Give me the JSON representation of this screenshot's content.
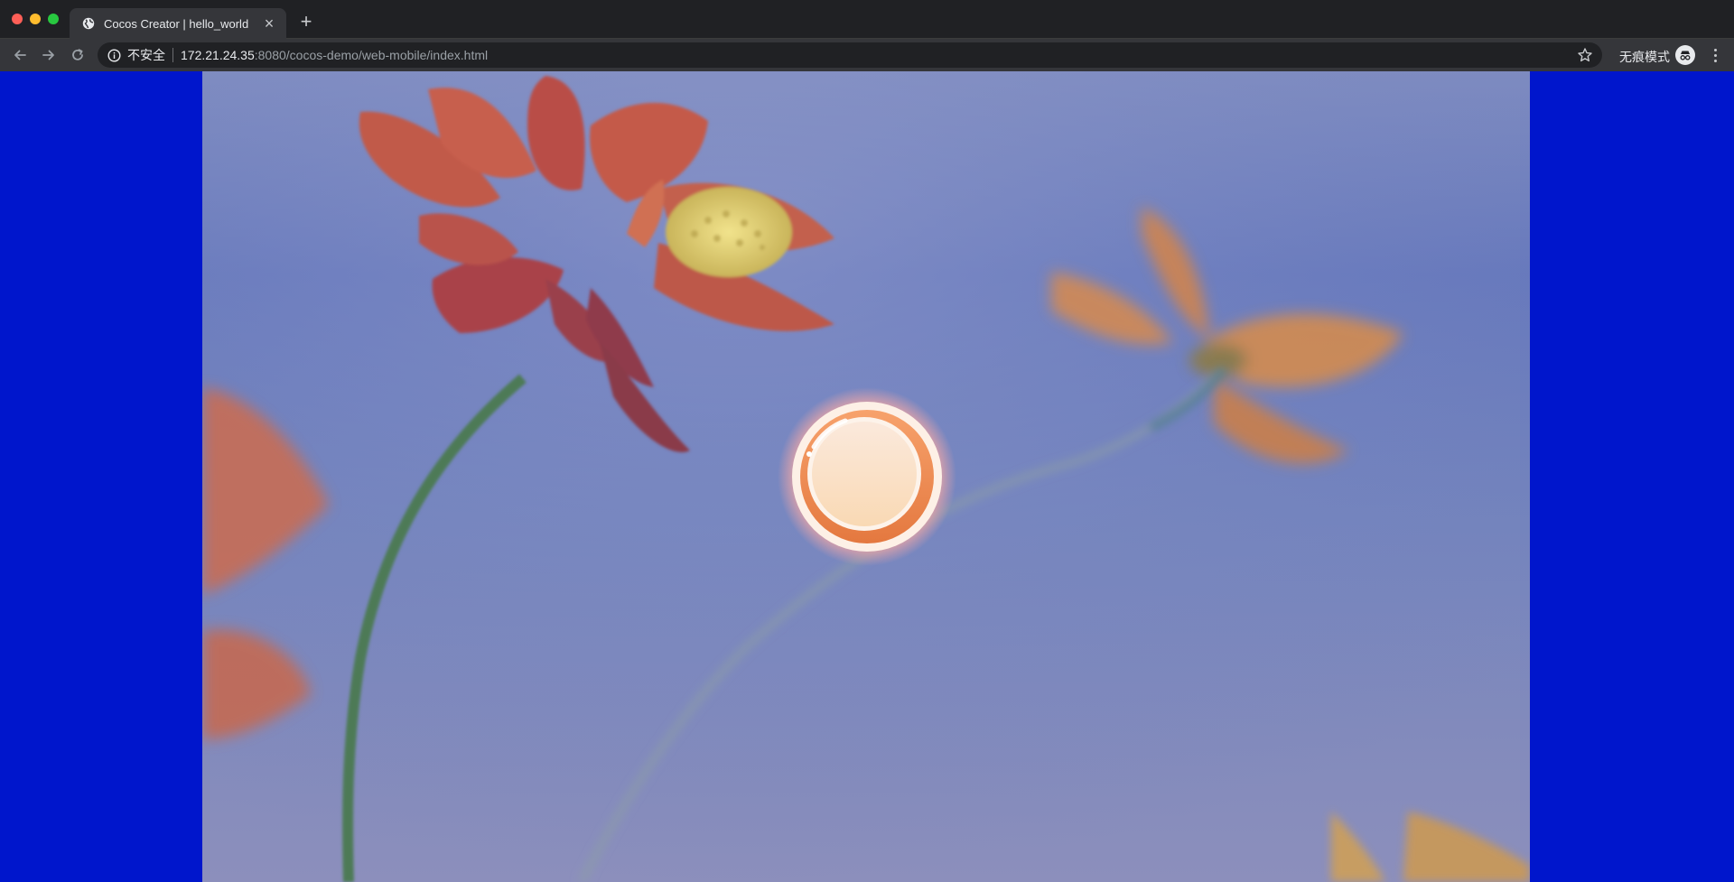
{
  "browser": {
    "tab": {
      "title": "Cocos Creator | hello_world",
      "favicon": "globe-icon",
      "close": "×"
    },
    "new_tab": "+",
    "toolbar": {
      "security_label": "不安全",
      "url_host": "172.21.24.35",
      "url_path": ":8080/cocos-demo/web-mobile/index.html",
      "incognito_label": "无痕模式"
    }
  },
  "page": {
    "background_color": "#0016cc",
    "scene": {
      "description_icon": "flower-background",
      "button": "play-button"
    }
  },
  "colors": {
    "chrome_dark": "#202124",
    "chrome_mid": "#35363a",
    "letterbox_blue": "#0016cc",
    "sky": "#6678bc",
    "petal_red": "#c25a4e",
    "button_orange": "#f08b56",
    "button_cream": "#fbe4cf"
  }
}
